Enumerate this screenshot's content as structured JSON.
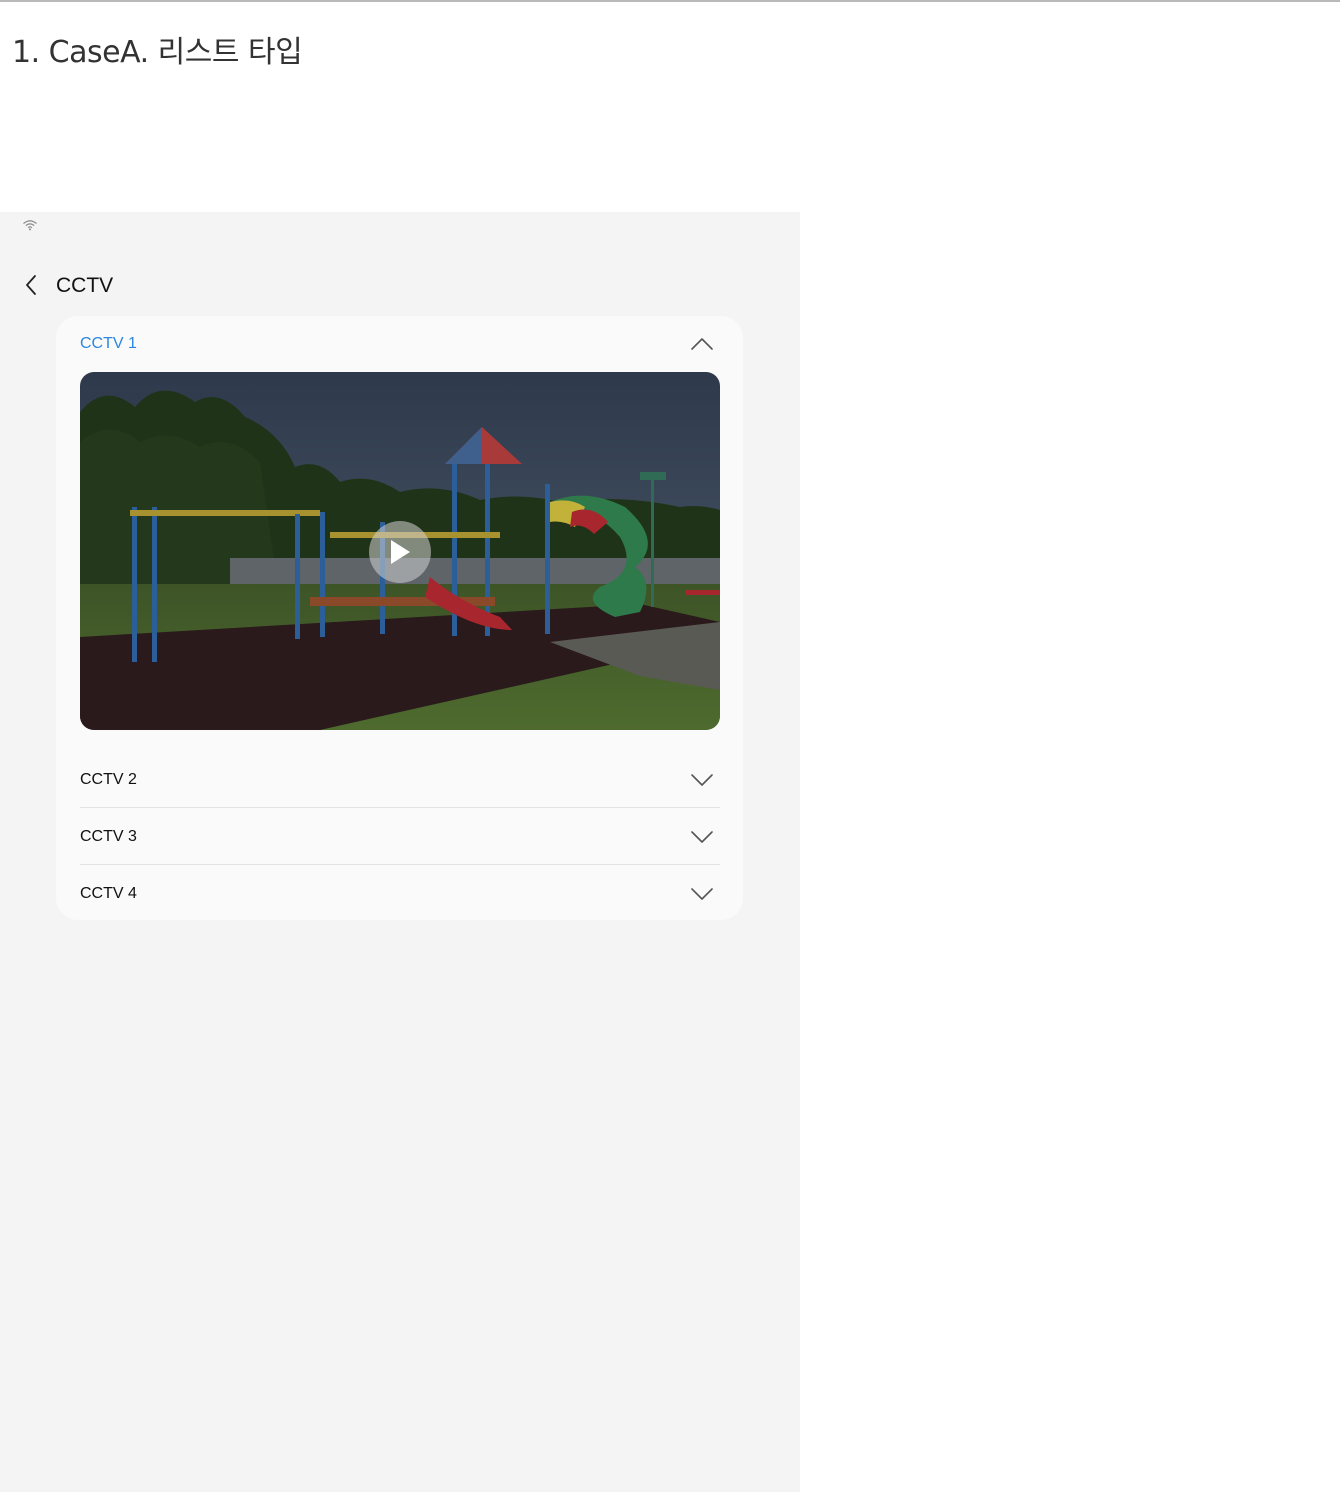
{
  "document": {
    "title": "1. CaseA. 리스트 타입"
  },
  "status_bar": {
    "icon": "wifi-icon"
  },
  "app_bar": {
    "back_icon": "chevron-left-icon",
    "title": "CCTV"
  },
  "cctv_list": {
    "accent_color": "#2b86e0",
    "items": [
      {
        "label": "CCTV 1",
        "expanded": true,
        "icon": "chevron-up-icon"
      },
      {
        "label": "CCTV 2",
        "expanded": false,
        "icon": "chevron-down-icon"
      },
      {
        "label": "CCTV 3",
        "expanded": false,
        "icon": "chevron-down-icon"
      },
      {
        "label": "CCTV 4",
        "expanded": false,
        "icon": "chevron-down-icon"
      }
    ]
  },
  "video": {
    "content": "playground-camera-feed",
    "play_icon": "play-icon"
  }
}
